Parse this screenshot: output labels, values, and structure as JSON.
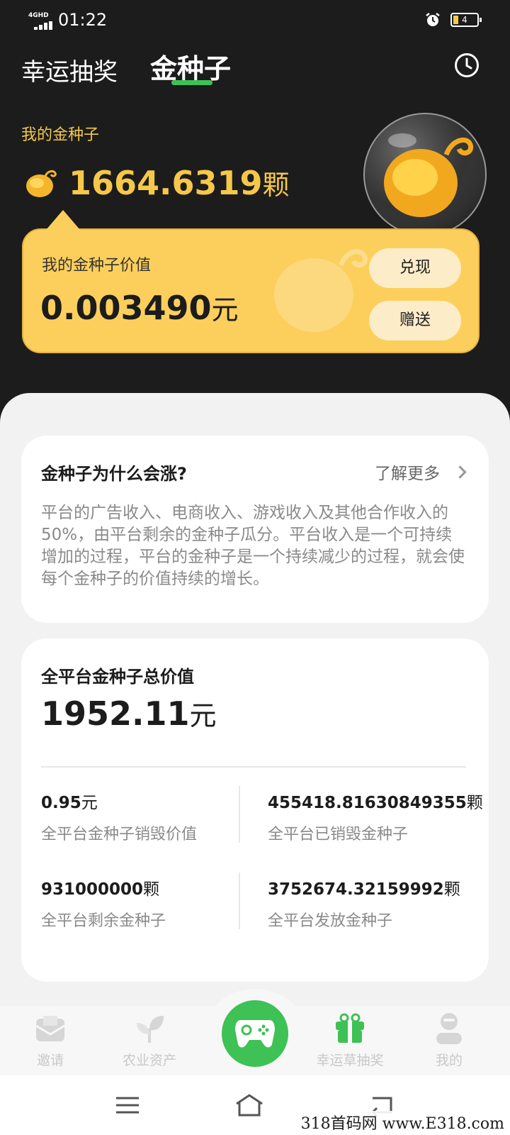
{
  "status_bar": {
    "network": "4GHD",
    "time": "01:22",
    "battery": "4"
  },
  "header": {
    "tabs": [
      "幸运抽奖",
      "金种子"
    ]
  },
  "my_seeds": {
    "label": "我的金种子",
    "amount": "1664.6319",
    "unit": "颗"
  },
  "value_card": {
    "label": "我的金种子价值",
    "amount": "0.003490",
    "unit": "元",
    "cash_button": "兑现",
    "gift_button": "赠送"
  },
  "why_card": {
    "title": "金种子为什么会涨?",
    "more_link": "了解更多",
    "description": "平台的广告收入、电商收入、游戏收入及其他合作收入的50%，由平台剩余的金种子瓜分。平台收入是一个可持续增加的过程，平台的金种子是一个持续减少的过程，就会使每个金种子的价值持续的增长。"
  },
  "total_card": {
    "title": "全平台金种子总价值",
    "amount": "1952.11",
    "unit": "元",
    "stats": [
      {
        "value": "0.95",
        "unit": "元",
        "label": "全平台金种子销毁价值"
      },
      {
        "value": "455418.81630849355",
        "unit": "颗",
        "label": "全平台已销毁金种子"
      },
      {
        "value": "931000000",
        "unit": "颗",
        "label": "全平台剩余金种子"
      },
      {
        "value": "3752674.32159992",
        "unit": "颗",
        "label": "全平台发放金种子"
      }
    ]
  },
  "bottom_nav": {
    "items": [
      {
        "label": "邀请",
        "icon": "envelope-icon"
      },
      {
        "label": "农业资产",
        "icon": "sprout-icon"
      },
      {
        "label": "幸运草抽奖",
        "icon": "gift-icon",
        "active": true
      },
      {
        "label": "我的",
        "icon": "profile-icon"
      }
    ],
    "center_icon": "gamepad-icon"
  },
  "watermark": "318首码网 www.E318.com",
  "colors": {
    "gold": "#f5c84a",
    "card": "#fccf5c",
    "green": "#3ec155",
    "dark": "#1c1c1c"
  }
}
